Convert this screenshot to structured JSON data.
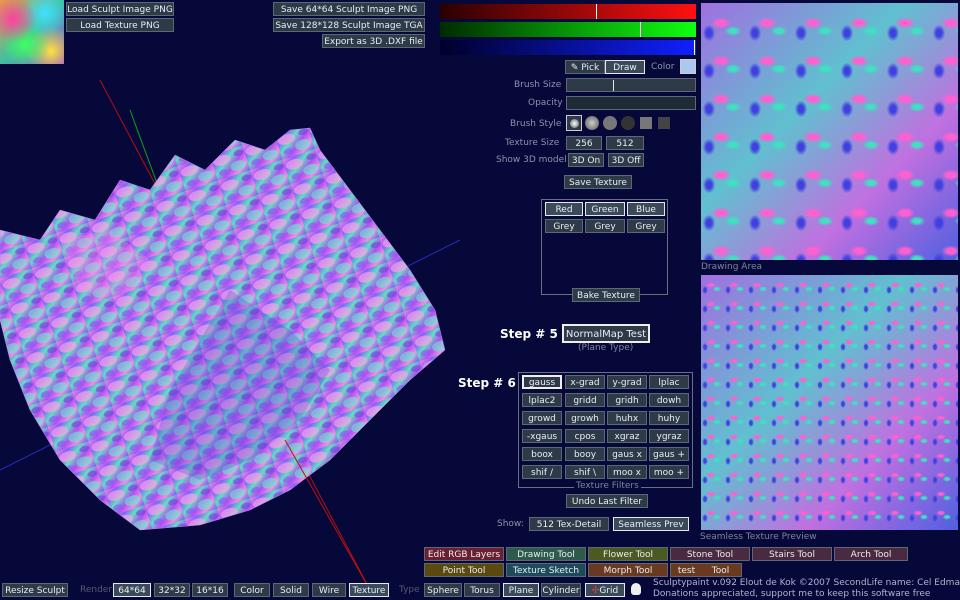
{
  "top_left": {
    "load_sculpt": "Load Sculpt Image PNG",
    "load_texture": "Load Texture PNG"
  },
  "top_mid": {
    "save_64": "Save 64*64 Sculpt Image PNG",
    "save_128": "Save 128*128 Sculpt Image TGA",
    "export_dxf": "Export as 3D .DXF file"
  },
  "color_bars": {
    "red_value": 0.61,
    "green_value": 0.78,
    "blue_value": 1.0,
    "red_color": "#e0101a",
    "green_color": "#10c010",
    "blue_color": "#1020e0"
  },
  "tools": {
    "pick": "Pick",
    "draw": "Draw",
    "color_label": "Color",
    "current_color": "#aac8f0",
    "brush_size_label": "Brush Size",
    "brush_size_value": 0.36,
    "opacity_label": "Opacity",
    "brush_style_label": "Brush Style",
    "texture_size_label": "Texture Size",
    "tex_256": "256",
    "tex_512": "512",
    "show3d_label": "Show 3D model",
    "on": "3D On",
    "off": "3D Off",
    "save_texture": "Save Texture"
  },
  "bake": {
    "red": "Red",
    "green": "Green",
    "blue": "Blue",
    "grey1": "Grey",
    "grey2": "Grey",
    "grey3": "Grey",
    "bake_texture": "Bake Texture"
  },
  "step5": {
    "label": "Step # 5",
    "normalmap": "NormalMap Test",
    "sub": "(Plane Type)"
  },
  "step6": {
    "label": "Step # 6",
    "filters": [
      [
        "gauss",
        "x-grad",
        "y-grad",
        "lplac"
      ],
      [
        "lplac2",
        "gridd",
        "gridh",
        "dowh"
      ],
      [
        "growd",
        "growh",
        "huhx",
        "huhy"
      ],
      [
        "-xgaus",
        "cpos",
        "xgraz",
        "ygraz"
      ],
      [
        "boox",
        "booy",
        "gaus x",
        "gaus +"
      ],
      [
        "shif /",
        "shif \\",
        "moo x",
        "moo +"
      ]
    ],
    "filters_title": "Texture Filters",
    "undo": "Undo Last Filter"
  },
  "show_row": {
    "label": "Show:",
    "tex_detail": "512 Tex-Detail",
    "seamless": "Seamless Prev",
    "seamless_caption": "Seamless Texture Preview"
  },
  "drawing_area_caption": "Drawing Area",
  "bottom_tools": {
    "row1": [
      "Edit RGB Layers",
      "Drawing Tool",
      "Flower Tool",
      "Stone Tool",
      "Stairs Tool",
      "Arch Tool"
    ],
    "row2": [
      "Point Tool",
      "Texture Sketch",
      "Morph Tool",
      "test",
      "Tool"
    ]
  },
  "bottom_bar": {
    "resize": "Resize Sculpt",
    "render_label": "Render",
    "r64": "64*64",
    "r32": "32*32",
    "r16": "16*16",
    "color": "Color",
    "solid": "Solid",
    "wire": "Wire",
    "texture": "Texture",
    "type_label": "Type",
    "sphere": "Sphere",
    "torus": "Torus",
    "plane": "Plane",
    "cylinder": "Cylinder",
    "grid": "Grid",
    "credits1": "Sculptypaint v.092  Elout de Kok ©2007  SecondLife name: Cel Edman",
    "credits2": "Donations appreciated, support me to keep this software free"
  }
}
